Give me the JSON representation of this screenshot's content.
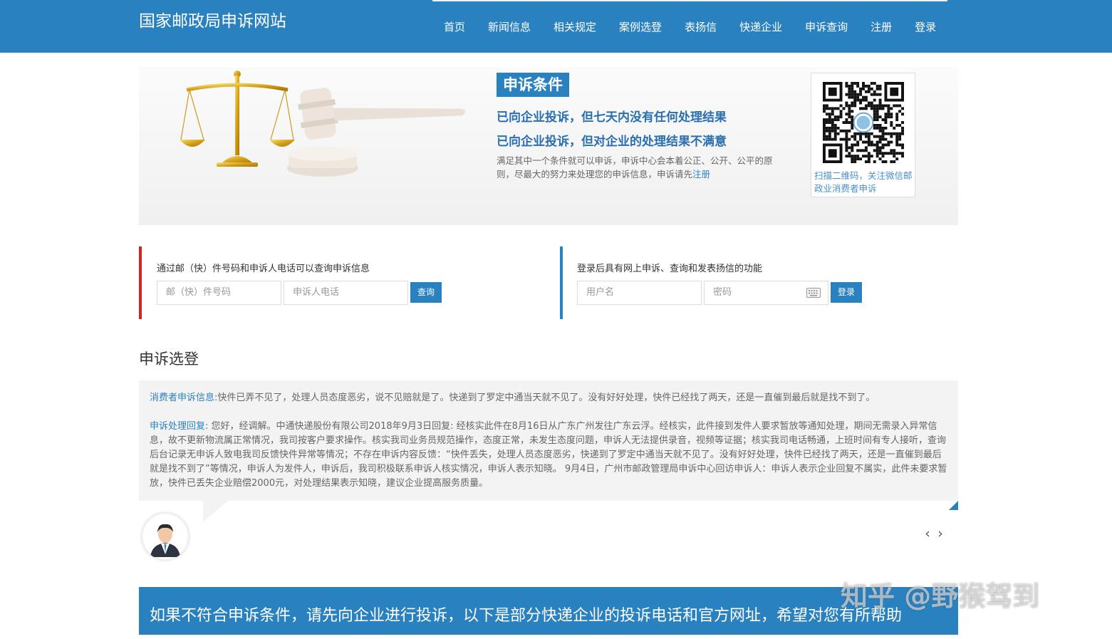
{
  "header": {
    "site_title": "国家邮政局申诉网站",
    "nav": [
      "首页",
      "新闻信息",
      "相关规定",
      "案例选登",
      "表扬信",
      "快递企业",
      "申诉查询",
      "注册",
      "登录"
    ]
  },
  "banner": {
    "badge": "申诉条件",
    "condition_1": "已向企业投诉，但七天内没有任何处理结果",
    "condition_2": "已向企业投诉，但对企业的处理结果不满意",
    "description": "满足其中一个条件就可以申诉，申诉中心会本着公正、公开、公平的原则，尽最大的努力来处理您的申诉信息，申诉请先",
    "register_link": "注册",
    "qr_caption": "扫描二维码，关注微信邮政业消费者申诉"
  },
  "query_panel": {
    "label": "通过邮（快）件号码和申诉人电话可以查询申诉信息",
    "tracking_placeholder": "邮（快）件号码",
    "phone_placeholder": "申诉人电话",
    "button": "查询"
  },
  "login_panel": {
    "label": "登录后具有网上申诉、查询和发表扬信的功能",
    "username_placeholder": "用户名",
    "password_placeholder": "密码",
    "button": "登录"
  },
  "cases": {
    "title": "申诉选登",
    "info_tag": "消费者申诉信息:",
    "info_text": "快件已弄不见了，处理人员态度恶劣，说不见赔就是了。快递到了罗定中通当天就不见了。没有好好处理，快件已经找了两天，还是一直催到最后就是找不到了。",
    "reply_tag": "申诉处理回复:",
    "reply_text": " 您好，经调解。中通快递股份有限公司2018年9月3日回复: 经核实此件在8月16日从广东广州发往广东云浮。经核实，此件接到发件人要求暂放等通知处理，期间无需录入异常信息，故不更新物流属正常情况，我司按客户要求操作。核实我司业务员规范操作，态度正常，未发生态度问题，申诉人无法提供录音，视频等证据；核实我司电话畅通，上班时间有专人接听，查询后台记录无申诉人致电我司反馈快件异常等情况；不存在申诉内容反馈：“快件丢失，处理人员态度恶劣，快递到了罗定中通当天就不见了。没有好好处理，快件已经找了两天，还是一直催到最后就是找不到了”等情况，申诉人为发件人，申诉后，我司积极联系申诉人核实情况，申诉人表示知晓。 9月4日，广州市邮政管理局申诉中心回访申诉人：申诉人表示企业回复不属实，此件未要求暂放，快件已丢失企业赔偿2000元，对处理结果表示知晓，建议企业提高服务质量。",
    "prev": "‹",
    "next": "›"
  },
  "footer": {
    "text": "如果不符合申诉条件，请先向企业进行投诉，以下是部分快递企业的投诉电话和官方网址，希望对您有所帮助"
  },
  "watermark": "知乎 @野猴驾到",
  "colors": {
    "primary": "#2a81bf",
    "alert_red": "#d9201f",
    "condition_text": "#2a6fb0"
  }
}
